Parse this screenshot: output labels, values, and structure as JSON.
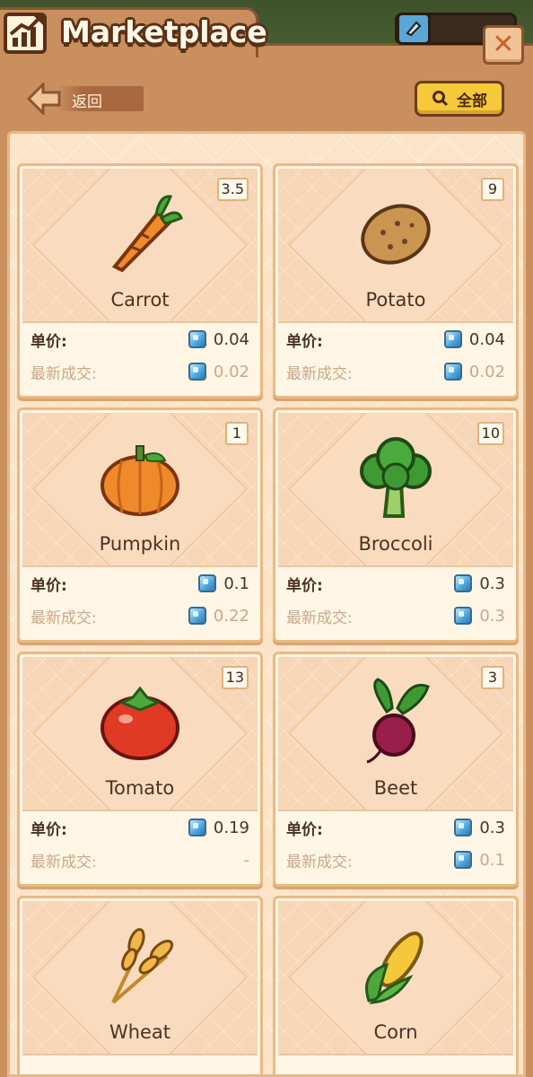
{
  "header": {
    "title": "Marketplace",
    "close_icon": "close-icon",
    "chart_icon": "trend-chart-icon"
  },
  "toolbar": {
    "back_label": "返回",
    "filter_label": "全部"
  },
  "labels": {
    "unit_price": "单价:",
    "last_trade": "最新成交:"
  },
  "items": [
    {
      "name": "Carrot",
      "qty": "3.5",
      "unit_price": "0.04",
      "last_trade": "0.02",
      "icon": "carrot-icon"
    },
    {
      "name": "Potato",
      "qty": "9",
      "unit_price": "0.04",
      "last_trade": "0.02",
      "icon": "potato-icon"
    },
    {
      "name": "Pumpkin",
      "qty": "1",
      "unit_price": "0.1",
      "last_trade": "0.22",
      "icon": "pumpkin-icon"
    },
    {
      "name": "Broccoli",
      "qty": "10",
      "unit_price": "0.3",
      "last_trade": "0.3",
      "icon": "broccoli-icon"
    },
    {
      "name": "Tomato",
      "qty": "13",
      "unit_price": "0.19",
      "last_trade": "-",
      "icon": "tomato-icon"
    },
    {
      "name": "Beet",
      "qty": "3",
      "unit_price": "0.3",
      "last_trade": "0.1",
      "icon": "beet-icon"
    },
    {
      "name": "Wheat",
      "qty": "",
      "unit_price": "",
      "last_trade": "",
      "icon": "wheat-icon"
    },
    {
      "name": "Corn",
      "qty": "",
      "unit_price": "",
      "last_trade": "",
      "icon": "corn-icon"
    }
  ],
  "colors": {
    "panel": "#c98f5e",
    "content_bg": "#fbe4c9",
    "accent_yellow": "#f5c93a",
    "gem_blue": "#4aa3dc"
  }
}
